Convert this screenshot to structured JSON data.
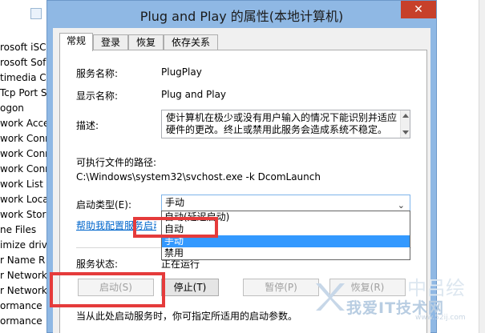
{
  "background_list": [
    "rosoft iSC",
    "rosoft Sof",
    "timedia Cl",
    "Tcp Port S",
    "ogon",
    "work Acce",
    "work Conr",
    "work Conr",
    "work Conr",
    "work List S",
    "work Loca",
    "work Stor",
    "ne Files",
    "imize driv",
    "r Name R",
    "r Network",
    "r Network",
    "ormance",
    "ormance"
  ],
  "dialog": {
    "title": "Plug and Play 的属性(本地计算机)",
    "close_glyph": "✕",
    "tabs": [
      "常规",
      "登录",
      "恢复",
      "依存关系"
    ]
  },
  "general": {
    "service_name_label": "服务名称:",
    "service_name": "PlugPlay",
    "display_name_label": "显示名称:",
    "display_name": "Plug and Play",
    "description_label": "描述:",
    "description": "使计算机在极少或没有用户输入的情况下能识别并适应硬件的更改。终止或禁用此服务会造成系统不稳定。",
    "exe_path_label": "可执行文件的路径:",
    "exe_path": "C:\\Windows\\system32\\svchost.exe -k DcomLaunch",
    "startup_type_label": "启动类型(E):",
    "startup_type_value": "手动",
    "startup_options": [
      "自动(延迟启动)",
      "自动",
      "手动",
      "禁用"
    ],
    "startup_selected_index": 2,
    "help_link": "帮助我配置服务启动",
    "service_status_label": "服务状态:",
    "service_status": "正在运行",
    "buttons": {
      "start": "启动(S)",
      "stop": "停止(T)",
      "pause": "暂停(P)",
      "resume": "恢复(R)"
    },
    "footer_note": "当从此处启动服务时，你可指定所适用的启动参数。"
  },
  "watermark": {
    "text": "我爱IT技术网",
    "url": "www.52ij.com",
    "cn": "中吕绘"
  },
  "colors": {
    "highlight_box": "#e53b3b",
    "selected_option": "#3399ff",
    "link": "#0066cc",
    "close_button": "#c7402a"
  }
}
